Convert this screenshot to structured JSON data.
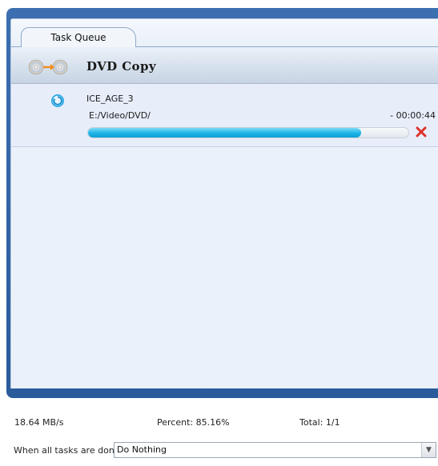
{
  "tab": {
    "label": "Task Queue"
  },
  "section": {
    "title": "DVD Copy",
    "icon": "dvd-copy-icon"
  },
  "task": {
    "name": "ICE_AGE_3",
    "path": "E:/Video/DVD/",
    "time_remaining": "- 00:00:44",
    "progress_percent": 85.16,
    "status_icon": "processing-spinner-icon",
    "cancel_icon": "close-icon"
  },
  "status": {
    "speed": "18.64 MB/s",
    "percent": "Percent: 85.16%",
    "total": "Total: 1/1"
  },
  "completion": {
    "label": "When all tasks are done:",
    "selected": "Do Nothing"
  },
  "colors": {
    "frame": "#2f62a5",
    "progress": "#1cb4e8",
    "cancel": "#e0302a"
  }
}
